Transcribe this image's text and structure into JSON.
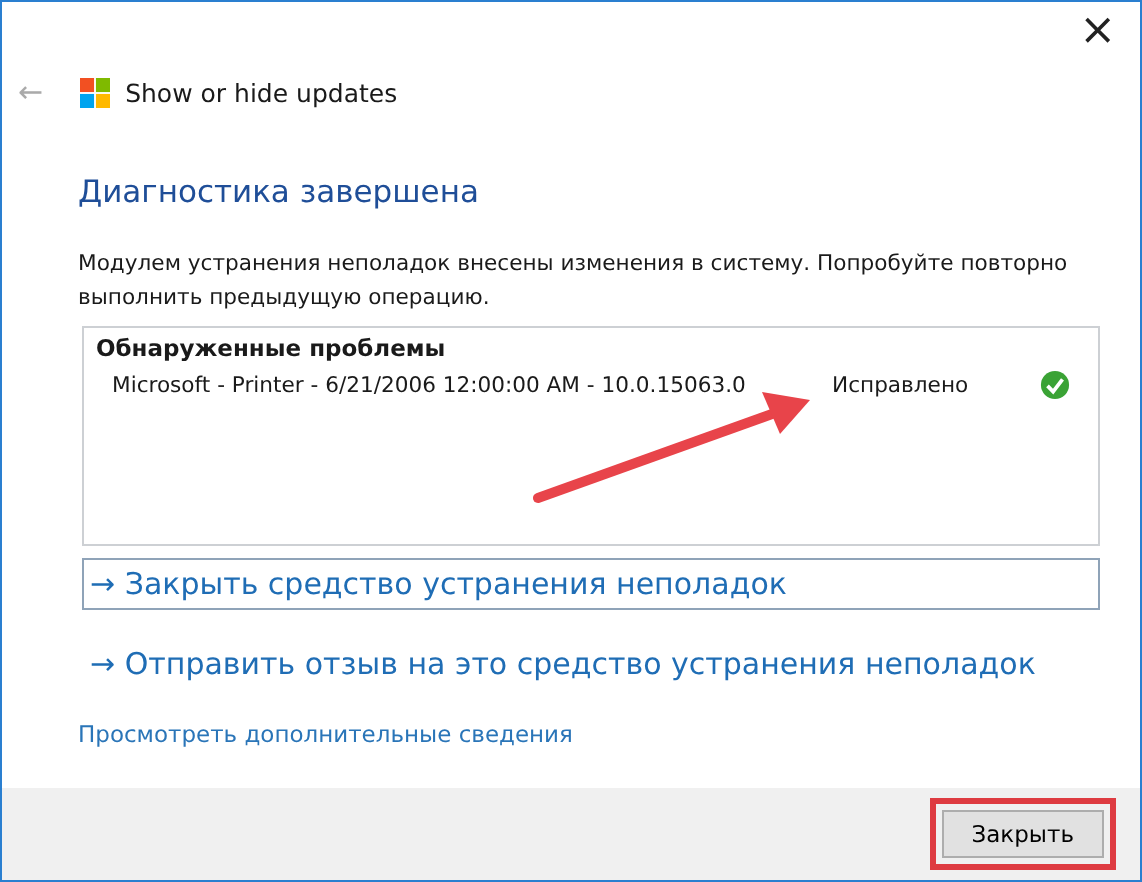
{
  "window": {
    "close": "×"
  },
  "header": {
    "back": "←",
    "title": "Show or hide updates"
  },
  "heading": "Диагностика завершена",
  "message": "Модулем устранения неполадок внесены изменения в систему. Попробуйте повторно выполнить предыдущую операцию.",
  "problems": {
    "title": "Обнаруженные проблемы",
    "rows": [
      {
        "name": "Microsoft - Printer - 6/21/2006 12:00:00 AM - 10.0.15063.0",
        "status": "Исправлено",
        "fixed": true
      }
    ]
  },
  "actions": [
    {
      "arrow": "→",
      "label": "Закрыть средство устранения неполадок",
      "focused": true
    },
    {
      "arrow": "→",
      "label": "Отправить отзыв на это средство устранения неполадок",
      "focused": false
    }
  ],
  "details_link": "Просмотреть дополнительные сведения",
  "footer": {
    "button": {
      "label": "Закрыть",
      "highlighted": true
    }
  }
}
